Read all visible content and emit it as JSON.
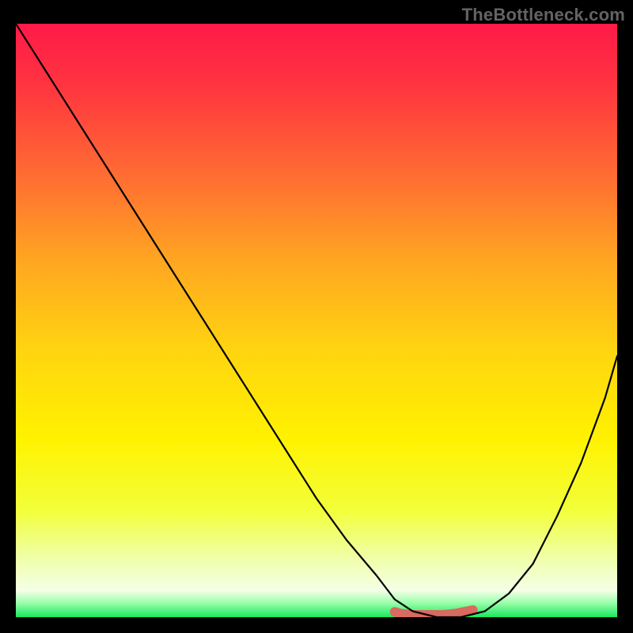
{
  "watermark": "TheBottleneck.com",
  "chart_data": {
    "type": "line",
    "title": "",
    "xlabel": "",
    "ylabel": "",
    "xlim": [
      0,
      100
    ],
    "ylim": [
      0,
      100
    ],
    "grid": false,
    "legend": false,
    "gradient_stops": [
      {
        "offset": 0.0,
        "color": "#ff1a48"
      },
      {
        "offset": 0.1,
        "color": "#ff3340"
      },
      {
        "offset": 0.25,
        "color": "#ff6a33"
      },
      {
        "offset": 0.4,
        "color": "#ffa621"
      },
      {
        "offset": 0.55,
        "color": "#ffd410"
      },
      {
        "offset": 0.7,
        "color": "#fff200"
      },
      {
        "offset": 0.82,
        "color": "#f2ff3a"
      },
      {
        "offset": 0.9,
        "color": "#efffa8"
      },
      {
        "offset": 0.955,
        "color": "#f5ffe7"
      },
      {
        "offset": 0.975,
        "color": "#9effad"
      },
      {
        "offset": 1.0,
        "color": "#17e85e"
      }
    ],
    "series": [
      {
        "name": "curve",
        "color": "#000000",
        "x": [
          0,
          5,
          10,
          15,
          20,
          25,
          30,
          35,
          40,
          45,
          50,
          55,
          60,
          63,
          66,
          70,
          74,
          78,
          82,
          86,
          90,
          94,
          98,
          100
        ],
        "values": [
          100,
          92,
          84,
          76,
          68,
          60,
          52,
          44,
          36,
          28,
          20,
          13,
          7,
          3,
          1,
          0,
          0,
          1,
          4,
          9,
          17,
          26,
          37,
          44
        ]
      },
      {
        "name": "highlight-bar",
        "color": "#d86a5f",
        "x": [
          63,
          64,
          65,
          66,
          67,
          68,
          69,
          70,
          71,
          72,
          73,
          74,
          75,
          76
        ],
        "values": [
          0.9,
          0.6,
          0.5,
          0.4,
          0.4,
          0.4,
          0.4,
          0.4,
          0.4,
          0.5,
          0.6,
          0.8,
          1.0,
          1.2
        ]
      }
    ]
  }
}
